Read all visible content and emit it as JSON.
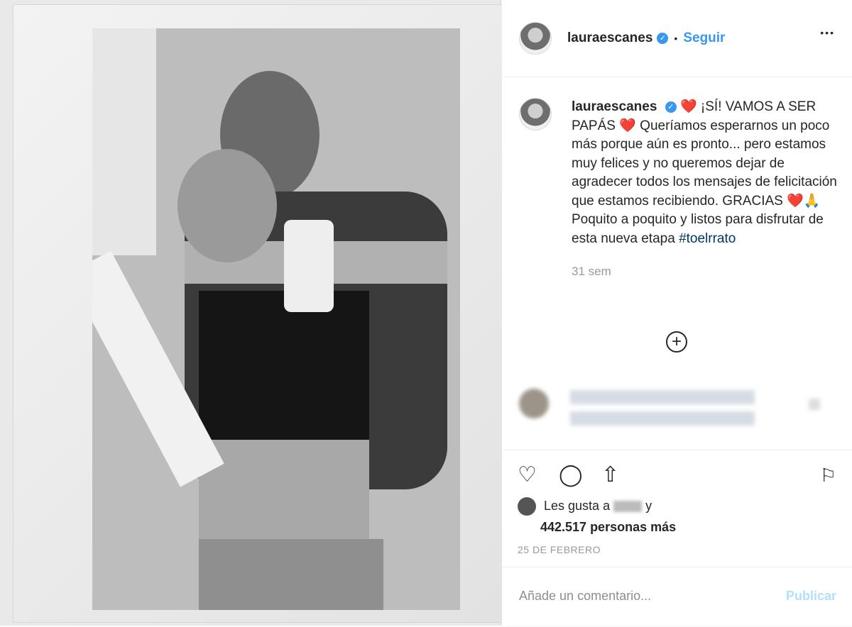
{
  "post": {
    "username": "lauraescanes",
    "follow_label": "Seguir",
    "dot": "•",
    "more": "•••",
    "caption": "❤️ ¡SÍ! VAMOS A SER PAPÁS ❤️ Queríamos esperarnos un poco más porque aún es pronto... pero estamos muy felices y no queremos dejar de agradecer todos los mensajes de felicitación que estamos recibiendo. GRACIAS ❤️🙏 Poquito a poquito y listos para disfrutar de esta nueva etapa",
    "hashtag": "#toelrrato",
    "time_ago": "31 sem",
    "load_more": "+"
  },
  "likes": {
    "prefix": "Les gusta a",
    "conj": "y",
    "count_text": "442.517 personas más"
  },
  "date": "25 DE FEBRERO",
  "comment": {
    "placeholder": "Añade un comentario...",
    "publish_label": "Publicar"
  }
}
